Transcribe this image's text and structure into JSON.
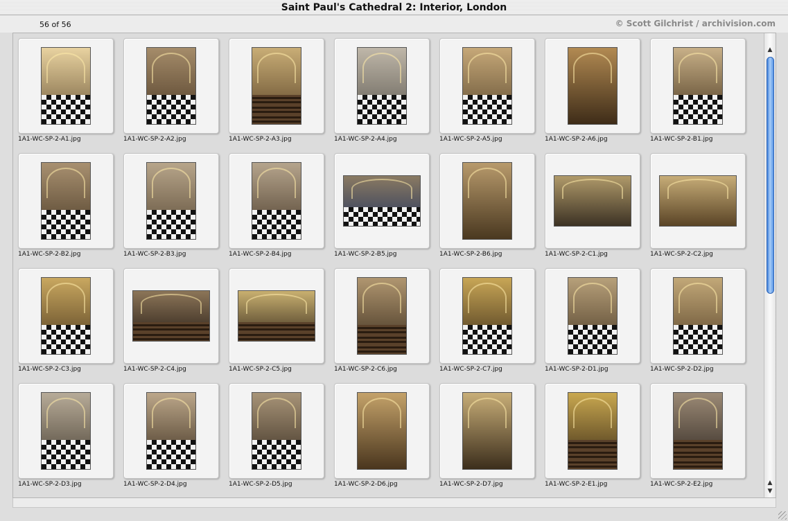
{
  "window": {
    "title": "Saint Paul's Cathedral 2: Interior, London"
  },
  "info": {
    "count": "56 of 56",
    "credit": "© Scott Gilchrist / archivision.com"
  },
  "thumbnails": [
    {
      "file": "1A1-WC-SP-2-A1.jpg",
      "orient": "portrait",
      "palette": [
        "#e8d2a0",
        "#6f5a3a"
      ],
      "floor": "check"
    },
    {
      "file": "1A1-WC-SP-2-A2.jpg",
      "orient": "portrait",
      "palette": [
        "#a58c6a",
        "#4d3a26"
      ],
      "floor": "check"
    },
    {
      "file": "1A1-WC-SP-2-A3.jpg",
      "orient": "portrait",
      "palette": [
        "#c9ad76",
        "#5b4428"
      ],
      "floor": "pews"
    },
    {
      "file": "1A1-WC-SP-2-A4.jpg",
      "orient": "portrait",
      "palette": [
        "#bfb7a9",
        "#5e5a52"
      ],
      "floor": "check"
    },
    {
      "file": "1A1-WC-SP-2-A5.jpg",
      "orient": "portrait",
      "palette": [
        "#c6a878",
        "#5c4a30"
      ],
      "floor": "check"
    },
    {
      "file": "1A1-WC-SP-2-A6.jpg",
      "orient": "portrait",
      "palette": [
        "#b28a52",
        "#3e2c18"
      ],
      "floor": "none"
    },
    {
      "file": "1A1-WC-SP-2-B1.jpg",
      "orient": "portrait",
      "palette": [
        "#c8b088",
        "#4a3820"
      ],
      "floor": "check"
    },
    {
      "file": "1A1-WC-SP-2-B2.jpg",
      "orient": "portrait",
      "palette": [
        "#a89070",
        "#4c3c28"
      ],
      "floor": "check"
    },
    {
      "file": "1A1-WC-SP-2-B3.jpg",
      "orient": "portrait",
      "palette": [
        "#b7a58a",
        "#5a4a36"
      ],
      "floor": "check"
    },
    {
      "file": "1A1-WC-SP-2-B4.jpg",
      "orient": "portrait",
      "palette": [
        "#b5a48c",
        "#4b3c2c"
      ],
      "floor": "check"
    },
    {
      "file": "1A1-WC-SP-2-B5.jpg",
      "orient": "landscape",
      "palette": [
        "#8a7a62",
        "#2c3a5e"
      ],
      "floor": "check"
    },
    {
      "file": "1A1-WC-SP-2-B6.jpg",
      "orient": "portrait",
      "palette": [
        "#b89a6c",
        "#4a3820"
      ],
      "floor": "none"
    },
    {
      "file": "1A1-WC-SP-2-C1.jpg",
      "orient": "landscape",
      "palette": [
        "#b09a6a",
        "#3c3224"
      ],
      "floor": "none"
    },
    {
      "file": "1A1-WC-SP-2-C2.jpg",
      "orient": "landscape",
      "palette": [
        "#c7ad78",
        "#5a4426"
      ],
      "floor": "none"
    },
    {
      "file": "1A1-WC-SP-2-C3.jpg",
      "orient": "portrait",
      "palette": [
        "#c9a860",
        "#4e3a1e"
      ],
      "floor": "check"
    },
    {
      "file": "1A1-WC-SP-2-C4.jpg",
      "orient": "landscape",
      "palette": [
        "#8c7558",
        "#2a2018"
      ],
      "floor": "pews"
    },
    {
      "file": "1A1-WC-SP-2-C5.jpg",
      "orient": "landscape",
      "palette": [
        "#c9b070",
        "#3c3020"
      ],
      "floor": "pews"
    },
    {
      "file": "1A1-WC-SP-2-C6.jpg",
      "orient": "portrait",
      "palette": [
        "#b09670",
        "#3a2c1c"
      ],
      "floor": "pews"
    },
    {
      "file": "1A1-WC-SP-2-C7.jpg",
      "orient": "portrait",
      "palette": [
        "#c8a656",
        "#3c2c18"
      ],
      "floor": "check"
    },
    {
      "file": "1A1-WC-SP-2-D1.jpg",
      "orient": "portrait",
      "palette": [
        "#b7a07a",
        "#4a3a26"
      ],
      "floor": "check"
    },
    {
      "file": "1A1-WC-SP-2-D2.jpg",
      "orient": "portrait",
      "palette": [
        "#c2a878",
        "#58432a"
      ],
      "floor": "check"
    },
    {
      "file": "1A1-WC-SP-2-D3.jpg",
      "orient": "portrait",
      "palette": [
        "#b7ab98",
        "#4a4236"
      ],
      "floor": "check"
    },
    {
      "file": "1A1-WC-SP-2-D4.jpg",
      "orient": "portrait",
      "palette": [
        "#bca78a",
        "#3e3020"
      ],
      "floor": "check"
    },
    {
      "file": "1A1-WC-SP-2-D5.jpg",
      "orient": "portrait",
      "palette": [
        "#a89478",
        "#3a2e22"
      ],
      "floor": "check"
    },
    {
      "file": "1A1-WC-SP-2-D6.jpg",
      "orient": "portrait",
      "palette": [
        "#c4a26a",
        "#4a361e"
      ],
      "floor": "none"
    },
    {
      "file": "1A1-WC-SP-2-D7.jpg",
      "orient": "portrait",
      "palette": [
        "#c8ae78",
        "#3c2e1c"
      ],
      "floor": "none"
    },
    {
      "file": "1A1-WC-SP-2-E1.jpg",
      "orient": "portrait",
      "palette": [
        "#c9a850",
        "#3a2a16"
      ],
      "floor": "pews"
    },
    {
      "file": "1A1-WC-SP-2-E2.jpg",
      "orient": "portrait",
      "palette": [
        "#9c8a76",
        "#2e2620"
      ],
      "floor": "pews"
    }
  ],
  "scrollbar": {
    "up_arrow": "▲",
    "down_arrow": "▼"
  }
}
